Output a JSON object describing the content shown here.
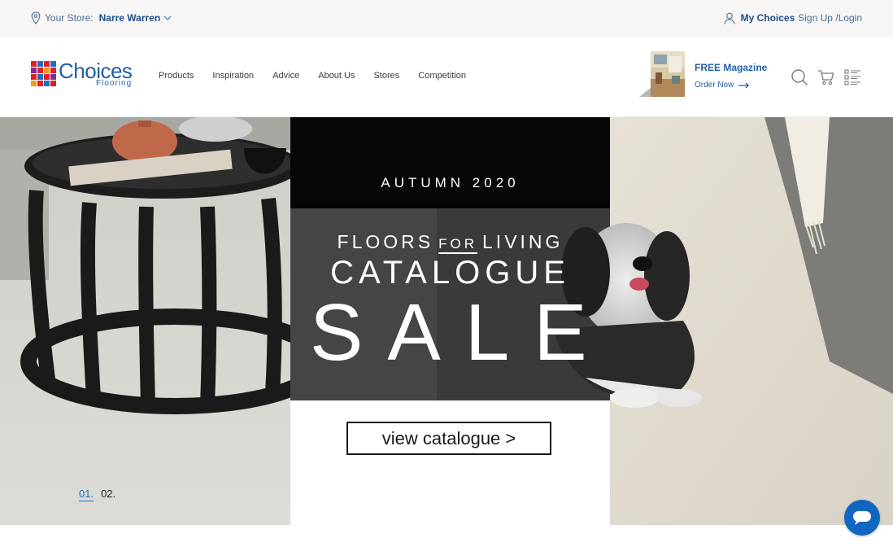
{
  "utility": {
    "store_label": "Your Store:",
    "store_name": "Narre Warren",
    "my_choices": "My Choices",
    "signup_login": "Sign Up /Login"
  },
  "logo": {
    "word": "Choices",
    "sub": "Flooring",
    "tile_colors": [
      "#e31e2a",
      "#1f6fc0",
      "#e31e2a",
      "#1f6fc0",
      "#8a2a8e",
      "#e31e2a",
      "#f29a1c",
      "#e31e2a",
      "#e31e2a",
      "#1f6fc0",
      "#e31e2a",
      "#8a2a8e",
      "#f29a1c",
      "#e31e2a",
      "#1f6fc0",
      "#e31e2a"
    ]
  },
  "nav": {
    "items": [
      "Products",
      "Inspiration",
      "Advice",
      "About Us",
      "Stores",
      "Competition"
    ]
  },
  "magazine": {
    "title": "FREE Magazine",
    "order": "Order Now"
  },
  "icons": {
    "search": "search-icon",
    "cart": "cart-icon",
    "list": "list-icon",
    "chat": "chat-icon"
  },
  "hero": {
    "season": "AUTUMN 2020",
    "line1_a": "FLOORS",
    "line1_for": "FOR",
    "line1_b": "LIVING",
    "line2": "CATALOGUE",
    "line3": "SALE",
    "cta": "view catalogue >",
    "slides": [
      "01.",
      "02."
    ]
  },
  "colors": {
    "brand_blue": "#1f5fa8",
    "chat_blue": "#1166c2",
    "hero_black": "#060606"
  }
}
